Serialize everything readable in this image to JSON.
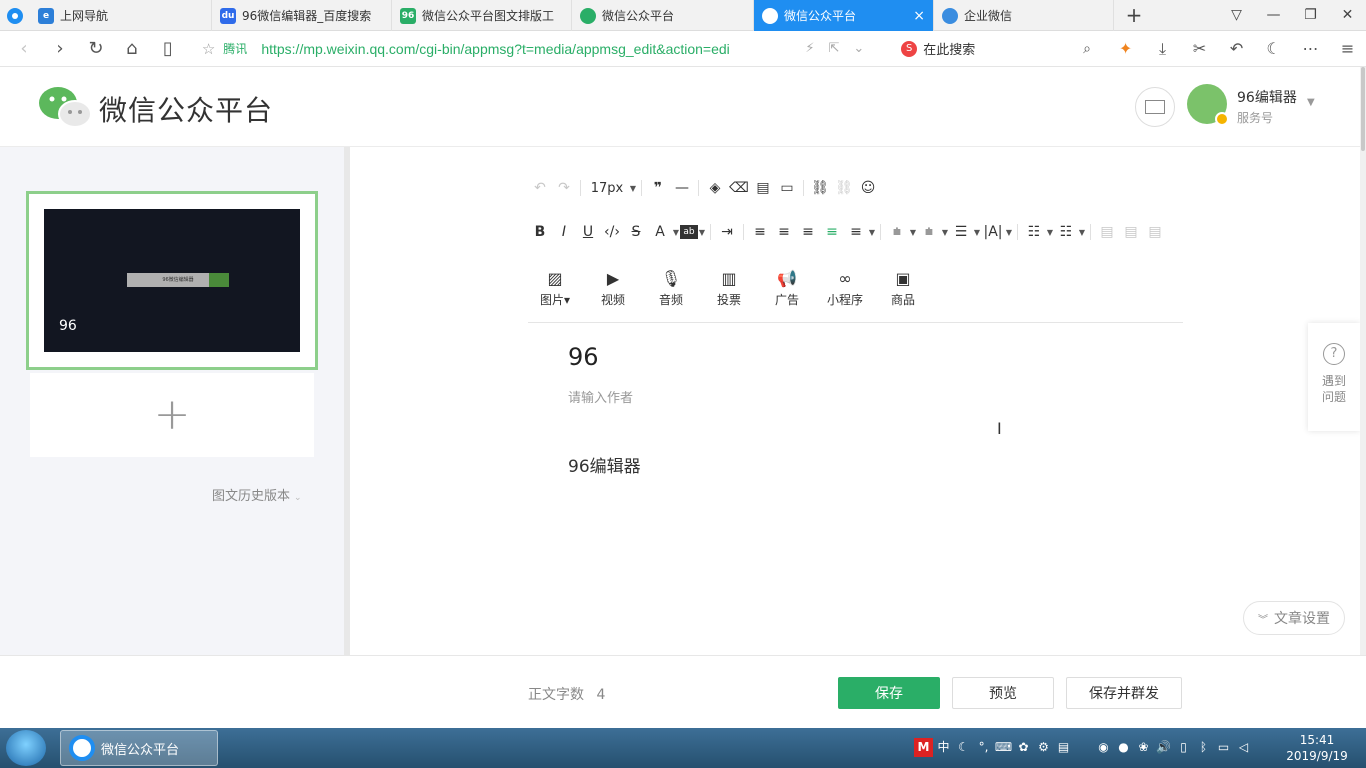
{
  "browser": {
    "tabs": [
      {
        "label": "上网导航",
        "icon": "e"
      },
      {
        "label": "96微信编辑器_百度搜索",
        "icon": "du"
      },
      {
        "label": "微信公众平台图文排版工",
        "icon": "96"
      },
      {
        "label": "微信公众平台",
        "icon": "wx"
      },
      {
        "label": "微信公众平台",
        "icon": "wx",
        "active": true
      },
      {
        "label": "企业微信",
        "icon": "wc"
      }
    ],
    "url": "https://mp.weixin.qq.com/cgi-bin/appmsg?t=media/appmsg_edit&action=edi",
    "site_badge": "腾讯",
    "search_placeholder": "在此搜索"
  },
  "header": {
    "title": "微信公众平台",
    "account_name": "96编辑器",
    "account_type": "服务号"
  },
  "sidebar": {
    "article_thumb_title": "96",
    "thumb_search_text": "96微信编辑器",
    "history_label": "图文历史版本"
  },
  "toolbar": {
    "font_size": "17px"
  },
  "media": [
    {
      "label": "图片",
      "icon": "image-icon"
    },
    {
      "label": "视频",
      "icon": "video-icon"
    },
    {
      "label": "音频",
      "icon": "microphone-icon"
    },
    {
      "label": "投票",
      "icon": "chart-icon"
    },
    {
      "label": "广告",
      "icon": "megaphone-icon"
    },
    {
      "label": "小程序",
      "icon": "link-icon"
    },
    {
      "label": "商品",
      "icon": "bag-icon"
    }
  ],
  "editor": {
    "title": "96",
    "author_placeholder": "请输入作者",
    "body": "96编辑器",
    "settings_label": "文章设置",
    "help_label": "遇到问题"
  },
  "footer": {
    "word_count_label": "正文字数",
    "word_count": "4",
    "save_label": "保存",
    "preview_label": "预览",
    "publish_label": "保存并群发"
  },
  "taskbar": {
    "app_label": "微信公众平台",
    "time": "15:41",
    "date": "2019/9/19"
  },
  "colors": {
    "accent_green": "#2aae67",
    "tab_blue": "#1f8ef1"
  }
}
